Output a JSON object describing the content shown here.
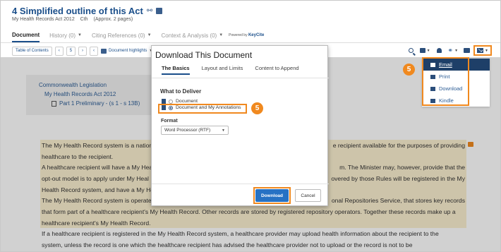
{
  "header": {
    "title": "4 Simplified outline of this Act",
    "subtitle": [
      "My Health Records Act 2012",
      "Cth",
      "(Approx. 2 pages)"
    ]
  },
  "tabs": [
    {
      "label": "Document",
      "active": true
    },
    {
      "label": "History (0)",
      "active": false
    },
    {
      "label": "Citing References (0)",
      "active": false
    },
    {
      "label": "Context & Analysis (0)",
      "active": false
    }
  ],
  "powered_by": {
    "prefix": "Powered by",
    "brand": "KeyCite"
  },
  "toolbar": {
    "toc_label": "Table of Contents",
    "page_number": "5",
    "highlights_label": "Document highlights"
  },
  "breadcrumb": [
    "Commonwealth Legislation",
    "My Health Records Act 2012",
    "Part 1 Preliminary - (s 1 - s 13B)"
  ],
  "paragraphs": [
    {
      "left": "The My Health Record system is a nation",
      "right": "e recipient available for the purposes of providing",
      "line2": "healthcare to the recipient."
    },
    {
      "left": "A healthcare recipient will have a My Heal",
      "right": "m. The Minister may, however, provide that the",
      "line2l": "opt-out model is to apply under My Heal",
      "line2r": "overed by those Rules will be registered in the My",
      "line3": "Health Record system, and have a My He"
    },
    {
      "left": "The My Health Record system is operate",
      "right": "onal Repositories Service, that stores key records",
      "line2": "that form part of a healthcare recipient's My Health Record. Other records are stored by registered repository operators. Together these records make up a",
      "line3": "healthcare recipient's My Health Record."
    },
    {
      "line1": "If a healthcare recipient is registered in the My Health Record system, a healthcare provider may upload health information about the recipient to the",
      "line2": "system, unless the record is one which the healthcare recipient has advised the healthcare provider not to upload or the record is not to be"
    }
  ],
  "modal": {
    "title": "Download This Document",
    "tabs": [
      {
        "label": "The Basics",
        "active": true
      },
      {
        "label": "Layout and Limits",
        "active": false
      },
      {
        "label": "Content to Append",
        "active": false
      }
    ],
    "section_title": "What to Deliver",
    "options": [
      {
        "label": "Document",
        "selected": false
      },
      {
        "label": "Document and My Annotations",
        "selected": true
      }
    ],
    "format_label": "Format",
    "format_value": "Word Processor (RTF)",
    "download_label": "Download",
    "cancel_label": "Cancel"
  },
  "step_badges": [
    "5",
    "5"
  ],
  "share_menu": {
    "items": [
      {
        "label": "Email",
        "icon": "envelope-icon",
        "active": true
      },
      {
        "label": "Print",
        "icon": "printer-icon",
        "active": false
      },
      {
        "label": "Download",
        "icon": "download-icon",
        "active": false
      },
      {
        "label": "Kindle",
        "icon": "kindle-icon",
        "active": false
      }
    ]
  },
  "colors": {
    "accent_orange": "#f0891f",
    "primary_blue": "#2672c4",
    "link_blue": "#2e5e96",
    "highlight": "#fbefd0"
  }
}
